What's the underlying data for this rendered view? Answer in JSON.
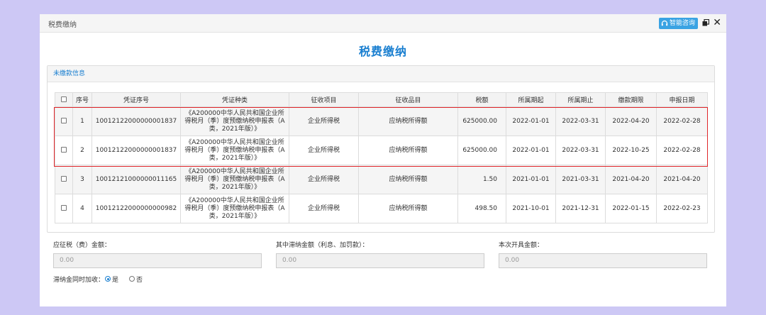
{
  "window": {
    "title": "税费缴纳",
    "consult_label": "智能咨询"
  },
  "page_title": "税费缴纳",
  "section_title": "未缴款信息",
  "table": {
    "headers": [
      "序号",
      "凭证序号",
      "凭证种类",
      "征收项目",
      "征收品目",
      "税额",
      "所属期起",
      "所属期止",
      "缴款期限",
      "申报日期"
    ],
    "rows": [
      {
        "no": "1",
        "voucher_no": "10012122000000001837",
        "voucher_type": "《A200000中华人民共和国企业所得税月（季）度预缴纳税申报表（A类，2021年版）》",
        "item": "企业所得税",
        "sub_item": "应纳税所得额",
        "amount": "625000.00",
        "start": "2022-01-01",
        "end": "2022-03-31",
        "due": "2022-04-20",
        "declared": "2022-02-28"
      },
      {
        "no": "2",
        "voucher_no": "10012122000000001837",
        "voucher_type": "《A200000中华人民共和国企业所得税月（季）度预缴纳税申报表（A类，2021年版）》",
        "item": "企业所得税",
        "sub_item": "应纳税所得额",
        "amount": "625000.00",
        "start": "2022-01-01",
        "end": "2022-03-31",
        "due": "2022-10-25",
        "declared": "2022-02-28"
      },
      {
        "no": "3",
        "voucher_no": "10012121000000011165",
        "voucher_type": "《A200000中华人民共和国企业所得税月（季）度预缴纳税申报表（A类，2021年版）》",
        "item": "企业所得税",
        "sub_item": "应纳税所得额",
        "amount": "1.50",
        "start": "2021-01-01",
        "end": "2021-03-31",
        "due": "2021-04-20",
        "declared": "2021-04-20"
      },
      {
        "no": "4",
        "voucher_no": "10012122000000000982",
        "voucher_type": "《A200000中华人民共和国企业所得税月（季）度预缴纳税申报表（A类，2021年版）》",
        "item": "企业所得税",
        "sub_item": "应纳税所得额",
        "amount": "498.50",
        "start": "2021-10-01",
        "end": "2021-12-31",
        "due": "2022-01-15",
        "declared": "2022-02-23"
      }
    ]
  },
  "amounts": {
    "payable_label": "应征税（费）金额：",
    "payable_value": "0.00",
    "late_fee_label": "其中滞纳金额（利息、加罚款）：",
    "late_fee_value": "0.00",
    "invoice_label": "本次开具金额：",
    "invoice_value": "0.00"
  },
  "late_fee_option": {
    "label": "滞纳金同时加收：",
    "yes_label": "是",
    "no_label": "否",
    "selected": "是"
  },
  "colors": {
    "accent": "#1a7fd0",
    "highlight": "#e0262a",
    "consult_button": "#3aa3e3",
    "backdrop": "#cdc8f5"
  }
}
